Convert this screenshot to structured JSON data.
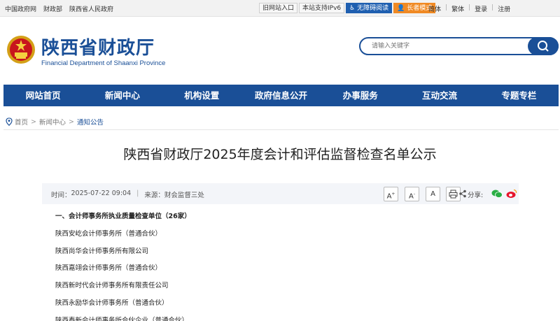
{
  "topbar": {
    "links": [
      "中国政府网",
      "财政部",
      "陕西省人民政府"
    ],
    "old_site": "旧网站入口",
    "ipv6": "本站支持IPv6",
    "accessible": "无障碍阅读",
    "elder": "长者模式",
    "lang_simplified": "简体",
    "lang_traditional": "繁体",
    "login": "登录",
    "register": "注册"
  },
  "header": {
    "title": "陕西省财政厅",
    "subtitle": "Financial Department of Shaanxi Province",
    "search_placeholder": "请输入关键字"
  },
  "nav": [
    "网站首页",
    "新闻中心",
    "机构设置",
    "政府信息公开",
    "办事服务",
    "互动交流",
    "专题专栏"
  ],
  "breadcrumb": {
    "home": "首页",
    "level1": "新闻中心",
    "current": "通知公告",
    "sep": ">"
  },
  "article": {
    "title": "陕西省财政厅2025年度会计和评估监督检查名单公示",
    "time_label": "时间：",
    "time": "2025-07-22 09:04",
    "source_label": "来源：",
    "source": "财会监督三处",
    "font_large": "A",
    "font_medium": "A",
    "font_small": "A",
    "share_label": "分享:",
    "section_heading": "一、会计师事务所执业质量检查单位（26家）",
    "items": [
      "陕西安屹会计师事务所（普通合伙）",
      "陕西尚华会计师事务所有限公司",
      "陕西嘉翊会计师事务所（普通合伙）",
      "陕西新时代会计师事务所有限责任公司",
      "陕西永励华会计师事务所（普通合伙）",
      "陕西泰新会计师事务所合伙企业（普通合伙）"
    ]
  },
  "colors": {
    "brand": "#1a4f97",
    "accent_orange": "#f08a24"
  }
}
